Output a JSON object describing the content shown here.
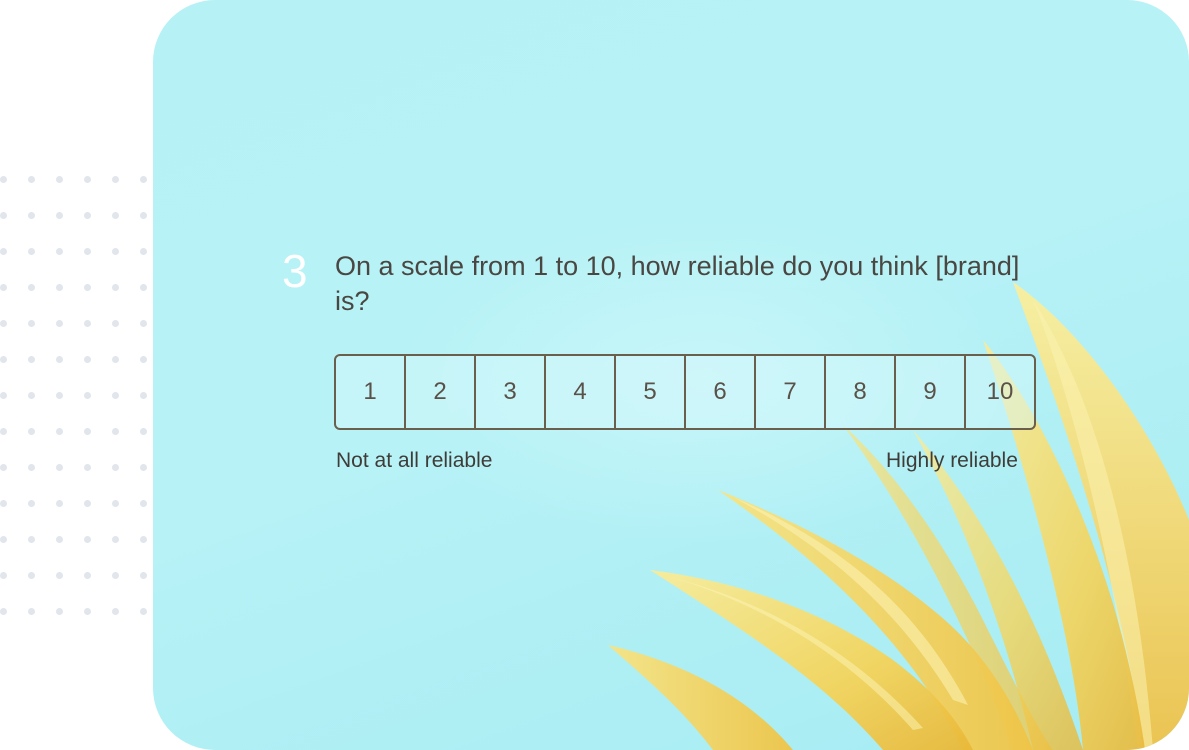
{
  "question": {
    "number": "3",
    "text": "On a scale from 1 to 10, how reliable do you think [brand] is?"
  },
  "scale": {
    "options": [
      "1",
      "2",
      "3",
      "4",
      "5",
      "6",
      "7",
      "8",
      "9",
      "10"
    ],
    "low_label": "Not at all reliable",
    "high_label": "Highly reliable"
  },
  "colors": {
    "card_background": "#b6f1f5",
    "petal": "#f5d96a",
    "scale_border": "#6a5e4c",
    "text": "#4a4743",
    "question_number": "#ffffff",
    "dots": "#e1e5ec"
  },
  "decorations": {
    "background_image": "yellow-flower-petals"
  }
}
